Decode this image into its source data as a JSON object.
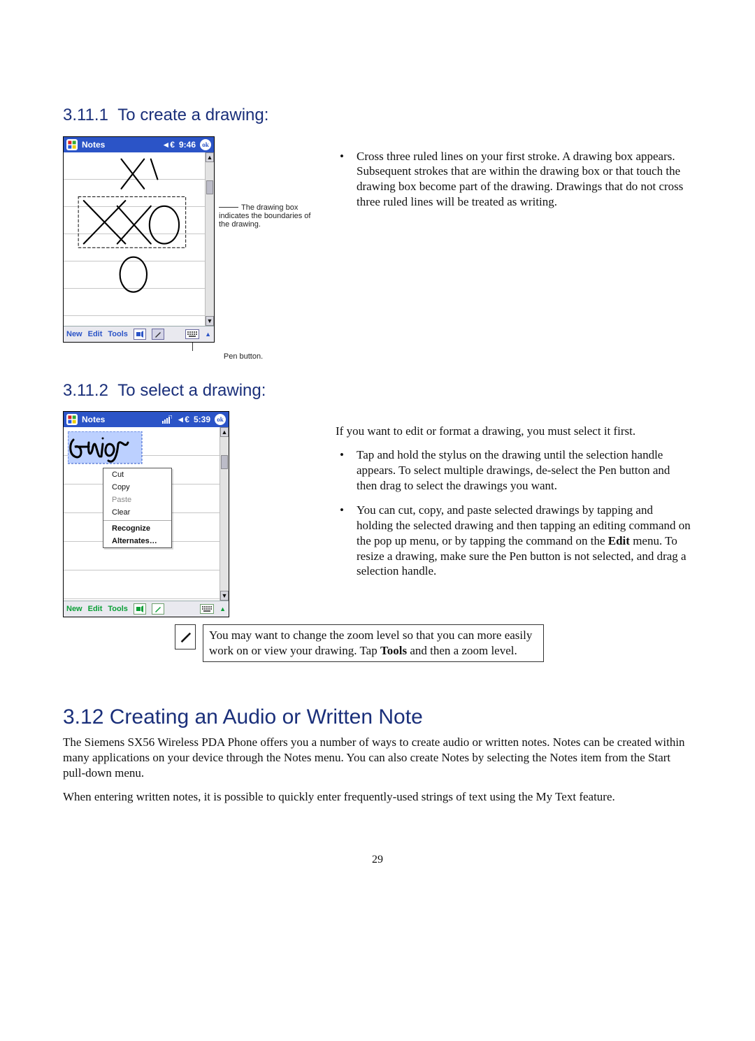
{
  "sections": {
    "s1": {
      "num": "3.11.1",
      "title": "To create a drawing:"
    },
    "s2": {
      "num": "3.11.2",
      "title": "To select a drawing:"
    },
    "s3": {
      "num": "3.12",
      "title": "Creating an Audio or Written Note"
    }
  },
  "screenshot1": {
    "app_title": "Notes",
    "clock_prefix": "◄€",
    "clock": "9:46",
    "ok": "ok",
    "menubar": {
      "new": "New",
      "edit": "Edit",
      "tools": "Tools"
    },
    "callout": "The drawing box indicates the boundaries of the drawing.",
    "pen_label": "Pen button."
  },
  "bullets1": [
    "Cross three ruled lines on your first stroke. A drawing box appears. Subsequent strokes that are within the drawing box or that touch the drawing box become part of the drawing. Drawings that do not cross three ruled lines will be treated as writing."
  ],
  "screenshot2": {
    "app_title": "Notes",
    "signal_icon": "signal-icon",
    "clock_prefix": "◄€",
    "clock": "5:39",
    "ok": "ok",
    "menubar": {
      "new": "New",
      "edit": "Edit",
      "tools": "Tools"
    },
    "ctxmenu": {
      "cut": "Cut",
      "copy": "Copy",
      "paste": "Paste",
      "clear": "Clear",
      "recognize": "Recognize",
      "alternates": "Alternates…"
    }
  },
  "s2_intro": "If you want to edit or format a drawing, you must select it first.",
  "bullets2": [
    "Tap and hold the stylus on the drawing until the selection handle appears. To select multiple drawings, de-select the Pen button and then drag to select the drawings you want.",
    "You can cut, copy, and paste selected drawings by tapping and holding the selected drawing and then tapping an editing command on the pop up menu, or by tapping the command on the Edit menu. To resize a drawing, make sure the Pen button is not selected, and drag a selection handle."
  ],
  "bullets2_bold": {
    "word": "Edit"
  },
  "tip": {
    "pre": "You may want to change the zoom level so that you can more easily work on or view your drawing. Tap ",
    "bold": "Tools",
    "post": " and then a zoom level."
  },
  "s3_paras": [
    "The Siemens SX56 Wireless PDA Phone offers you a number of ways to create audio or written notes.  Notes can be created within many applications on your device through the Notes menu.  You can also create Notes by selecting the Notes item from the Start pull-down menu.",
    "When entering written notes, it is possible to quickly enter frequently-used strings of text using the My Text feature."
  ],
  "page_number": "29"
}
